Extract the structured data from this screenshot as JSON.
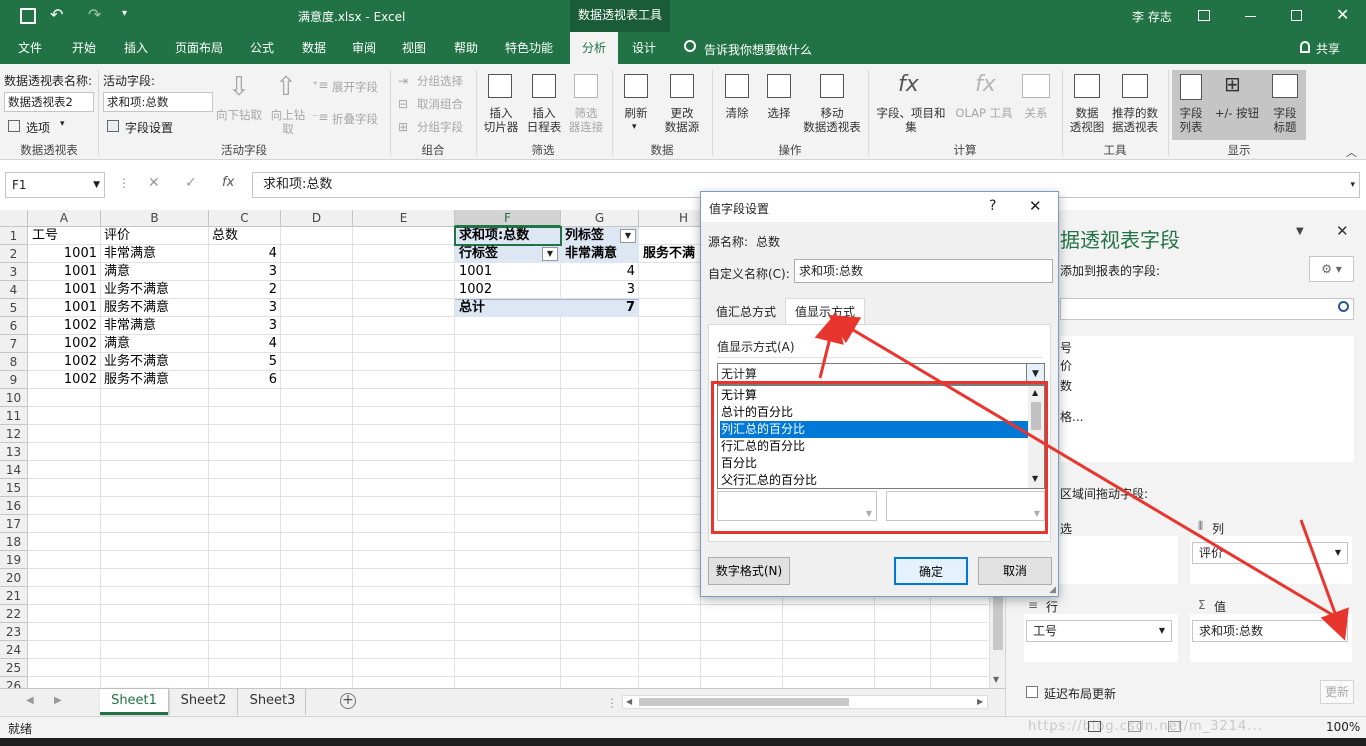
{
  "title": {
    "filename": "满意度.xlsx  -  Excel",
    "context_tab": "数据透视表工具",
    "user": "李 存志"
  },
  "tabs": [
    "文件",
    "开始",
    "插入",
    "页面布局",
    "公式",
    "数据",
    "审阅",
    "视图",
    "帮助",
    "特色功能",
    "分析",
    "设计"
  ],
  "tell_me": "告诉我你想要做什么",
  "share": "共享",
  "ribbon": {
    "pt_name_label": "数据透视表名称:",
    "pt_name_value": "数据透视表2",
    "options": "选项",
    "group_pivot": "数据透视表",
    "active_field_label": "活动字段:",
    "active_field_value": "求和项:总数",
    "field_settings": "字段设置",
    "drill_down": "向下钻取",
    "drill_up": "向上钻取",
    "expand": "展开字段",
    "collapse": "折叠字段",
    "group_active": "活动字段",
    "group_sel": "分组选择",
    "ungroup": "取消组合",
    "group_field": "分组字段",
    "group_group": "组合",
    "slicer": "插入\n切片器",
    "timeline": "插入\n日程表",
    "filter_conn": "筛选\n器连接",
    "group_filter": "筛选",
    "refresh": "刷新",
    "change_source": "更改\n数据源",
    "group_data": "数据",
    "clear": "清除",
    "select": "选择",
    "move": "移动\n数据透视表",
    "group_actions": "操作",
    "fields_items": "字段、项目和\n集",
    "olap": "OLAP 工具",
    "relations": "关系",
    "group_calc": "计算",
    "pivotchart": "数据\n透视图",
    "recommended": "推荐的数\n据透视表",
    "group_tools": "工具",
    "field_list": "字段\n列表",
    "buttons": "+/- 按钮",
    "headers": "字段\n标题",
    "group_show": "显示"
  },
  "formula_bar": {
    "name_box": "F1",
    "formula": "求和项:总数"
  },
  "columns": [
    "A",
    "B",
    "C",
    "D",
    "E",
    "F",
    "G",
    "H"
  ],
  "rows": [
    "1",
    "2",
    "3",
    "4",
    "5",
    "6",
    "7",
    "8",
    "9",
    "10",
    "11",
    "12",
    "13",
    "14",
    "15",
    "16",
    "17",
    "18",
    "19",
    "20",
    "21",
    "22",
    "23",
    "24",
    "25",
    "26"
  ],
  "data_headers": [
    "工号",
    "评价",
    "总数"
  ],
  "data_rows": [
    [
      "1001",
      "非常满意",
      "4"
    ],
    [
      "1001",
      "满意",
      "3"
    ],
    [
      "1001",
      "业务不满意",
      "2"
    ],
    [
      "1001",
      "服务不满意",
      "3"
    ],
    [
      "1002",
      "非常满意",
      "3"
    ],
    [
      "1002",
      "满意",
      "4"
    ],
    [
      "1002",
      "业务不满意",
      "5"
    ],
    [
      "1002",
      "服务不满意",
      "6"
    ]
  ],
  "pivot": {
    "corner": "求和项:总数",
    "col_label": "列标签",
    "row_label": "行标签",
    "col1": "非常满意",
    "col2": "服务不满",
    "r1": "1001",
    "r1v": "4",
    "r2": "1002",
    "r2v": "3",
    "total": "总计",
    "total_v": "7"
  },
  "sheets": [
    "Sheet1",
    "Sheet2",
    "Sheet3"
  ],
  "status": {
    "ready": "就绪",
    "zoom": "100%",
    "watermark": "https://blog.csdn.net/m_3214..."
  },
  "panel": {
    "title": "据透视表字段",
    "subtitle": "添加到报表的字段:",
    "fields": [
      "号",
      "价",
      "数",
      "格..."
    ],
    "drag_text": "区域间拖动字段:",
    "filter_label": "选",
    "columns_label": "列",
    "columns_value": "评价",
    "rows_label": "行",
    "rows_value": "工号",
    "values_label": "值",
    "values_value": "求和项:总数",
    "defer": "延迟布局更新",
    "update": "更新"
  },
  "dialog": {
    "title": "值字段设置",
    "help": "?",
    "source_label": "源名称:",
    "source_value": "总数",
    "custom_label": "自定义名称(C):",
    "custom_value": "求和项:总数",
    "tab1": "值汇总方式",
    "tab2": "值显示方式",
    "show_as_label": "值显示方式(A)",
    "dropdown_value": "无计算",
    "options": [
      "无计算",
      "总计的百分比",
      "列汇总的百分比",
      "行汇总的百分比",
      "百分比",
      "父行汇总的百分比"
    ],
    "selected_index": 2,
    "number_format": "数字格式(N)",
    "ok": "确定",
    "cancel": "取消"
  },
  "colors": {
    "excel_green": "#217346",
    "selection_blue": "#0078d7",
    "annotation_red": "#e8352e"
  }
}
